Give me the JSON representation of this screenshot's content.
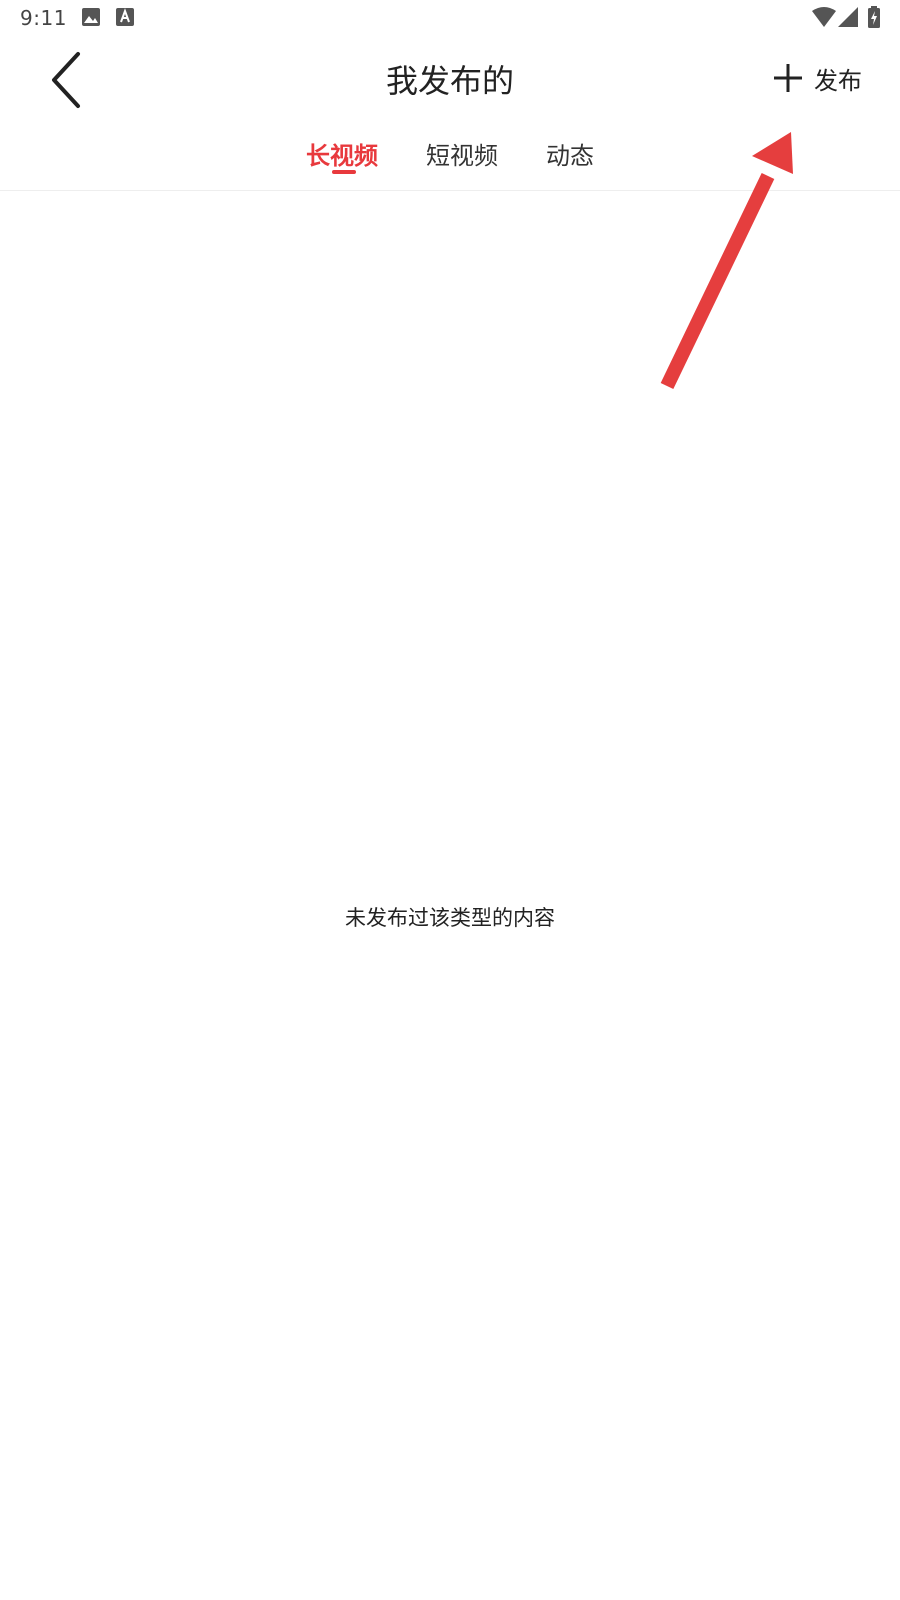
{
  "status_bar": {
    "time": "9:11",
    "icons": [
      "image-icon",
      "a-icon",
      "wifi-icon",
      "signal-icon",
      "battery-icon"
    ]
  },
  "header": {
    "title": "我发布的",
    "back_icon": "chevron-left-icon",
    "publish_label": "发布",
    "publish_icon": "plus-icon"
  },
  "tabs": [
    {
      "label": "长视频",
      "active": true
    },
    {
      "label": "短视频",
      "active": false
    },
    {
      "label": "动态",
      "active": false
    }
  ],
  "empty_state": {
    "message": "未发布过该类型的内容"
  },
  "colors": {
    "accent": "#e8393d",
    "text": "#222222",
    "divider": "#eeeeee",
    "annotation_arrow": "#e53e3e"
  }
}
